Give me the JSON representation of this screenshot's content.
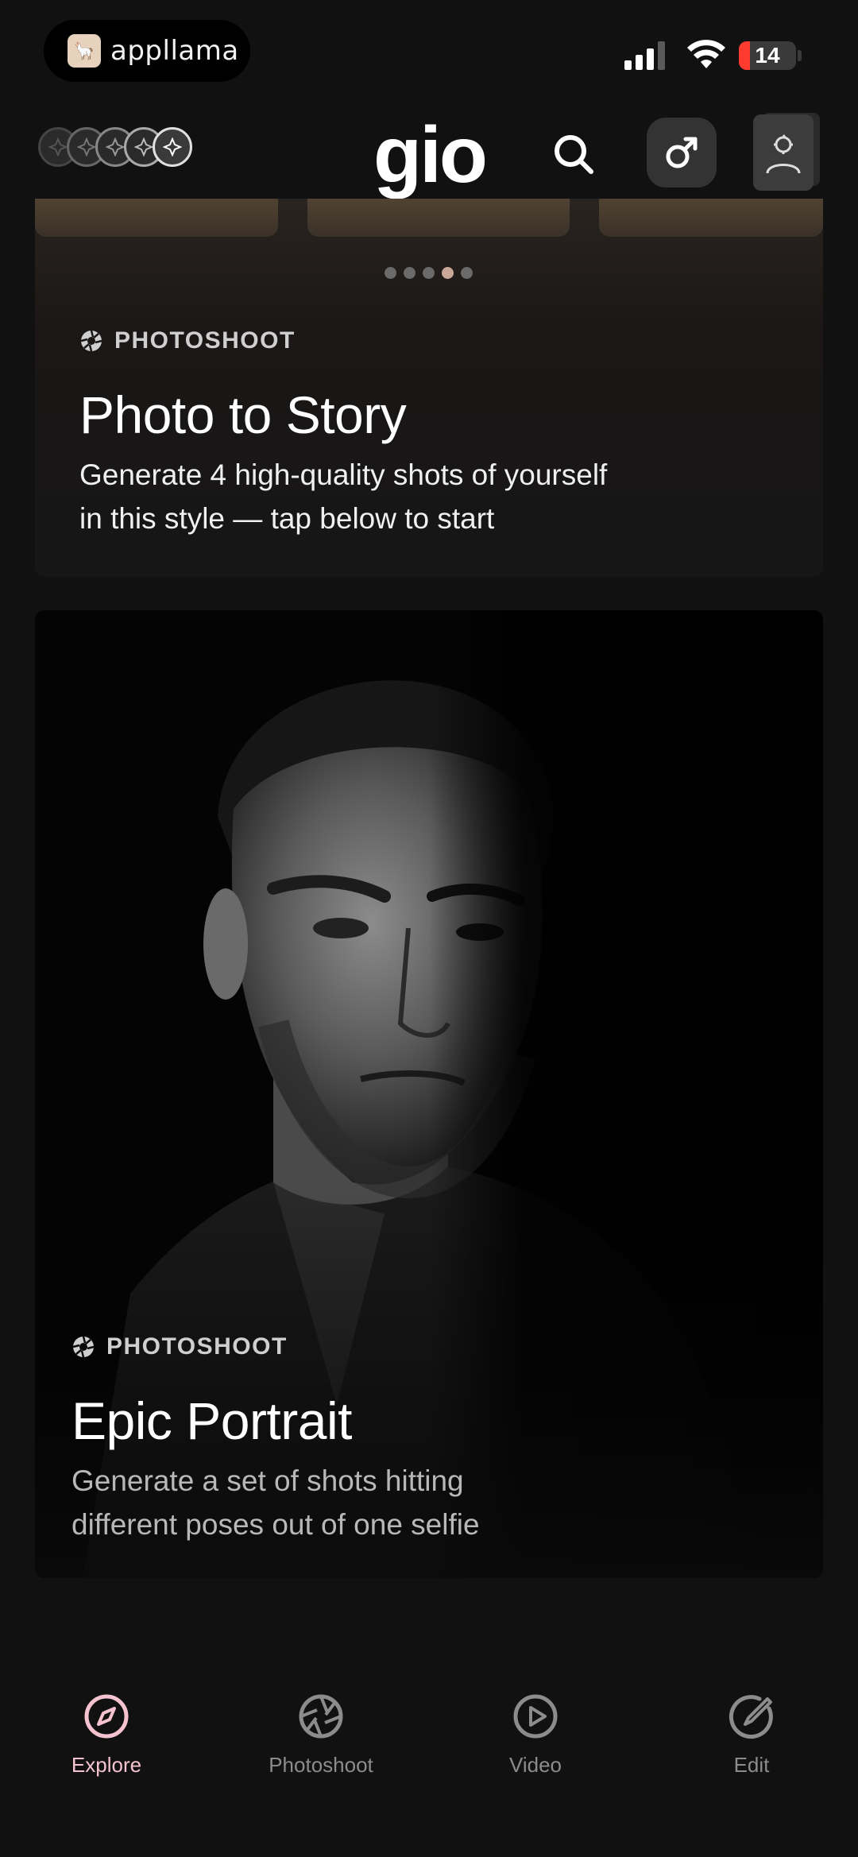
{
  "status_bar": {
    "app_badge": "appllama",
    "battery": "14"
  },
  "header": {
    "logo": "gio",
    "icons": [
      "credit-coin-icon",
      "search-icon",
      "male-gender-icon",
      "profile-icon"
    ]
  },
  "cards": [
    {
      "tag": "PHOTOSHOOT",
      "title": "Photo to Story",
      "description_lines": [
        "Generate 4 high-quality shots of yourself",
        "in this style — tap below to start"
      ],
      "carousel_dots": 5,
      "carousel_active": 4
    },
    {
      "tag": "PHOTOSHOOT",
      "title": "Epic Portrait",
      "description_lines": [
        "Generate a set of shots hitting",
        "different poses out of one selfie"
      ]
    }
  ],
  "bottom_nav": [
    {
      "label": "Explore",
      "icon": "compass-icon",
      "active": true
    },
    {
      "label": "Photoshoot",
      "icon": "aperture-icon",
      "active": false
    },
    {
      "label": "Video",
      "icon": "play-icon",
      "active": false
    },
    {
      "label": "Edit",
      "icon": "edit-icon",
      "active": false
    }
  ],
  "colors": {
    "background": "#111111",
    "accent_active": "#f4c3cf",
    "inactive": "#8c8c8c"
  }
}
